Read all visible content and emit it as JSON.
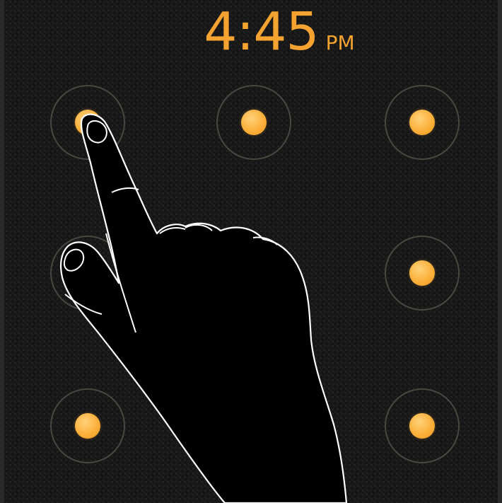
{
  "lock_screen": {
    "clock": {
      "time": "4:45",
      "ampm": "PM"
    },
    "pattern_grid": {
      "nodes": [
        {
          "id": "1",
          "state": "active"
        },
        {
          "id": "2",
          "state": "active"
        },
        {
          "id": "3",
          "state": "active"
        },
        {
          "id": "4",
          "state": "obscured"
        },
        {
          "id": "5",
          "state": "obscured"
        },
        {
          "id": "6",
          "state": "active"
        },
        {
          "id": "7",
          "state": "active"
        },
        {
          "id": "8",
          "state": "dimmed"
        },
        {
          "id": "9",
          "state": "active"
        }
      ]
    },
    "hand_graphic": "pointing-hand-illustration"
  },
  "colors": {
    "accent": "#f5a330",
    "dot": "#fbb03b",
    "ring": "#4a4640",
    "background": "#151515"
  }
}
